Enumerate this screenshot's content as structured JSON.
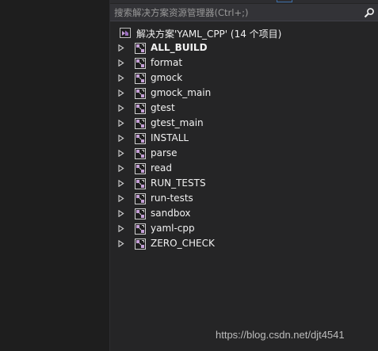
{
  "search": {
    "placeholder": "搜索解决方案资源管理器(Ctrl+;)",
    "value": ""
  },
  "solution": {
    "label": "解决方案'YAML_CPP' (14 个项目)",
    "icon": "solution-icon"
  },
  "projects": [
    {
      "label": "ALL_BUILD",
      "bold": true
    },
    {
      "label": "format",
      "bold": false
    },
    {
      "label": "gmock",
      "bold": false
    },
    {
      "label": "gmock_main",
      "bold": false
    },
    {
      "label": "gtest",
      "bold": false
    },
    {
      "label": "gtest_main",
      "bold": false
    },
    {
      "label": "INSTALL",
      "bold": false
    },
    {
      "label": "parse",
      "bold": false
    },
    {
      "label": "read",
      "bold": false
    },
    {
      "label": "RUN_TESTS",
      "bold": false
    },
    {
      "label": "run-tests",
      "bold": false
    },
    {
      "label": "sandbox",
      "bold": false
    },
    {
      "label": "yaml-cpp",
      "bold": false
    },
    {
      "label": "ZERO_CHECK",
      "bold": false
    }
  ],
  "icons": {
    "expander": "expand-arrow-icon",
    "project": "cpp-project-icon",
    "search": "search-icon"
  },
  "colors": {
    "panel_bg": "#252526",
    "text": "#f1f1f1",
    "project_icon": "#c6a0d8"
  },
  "watermark": "https://blog.csdn.net/djt4541"
}
